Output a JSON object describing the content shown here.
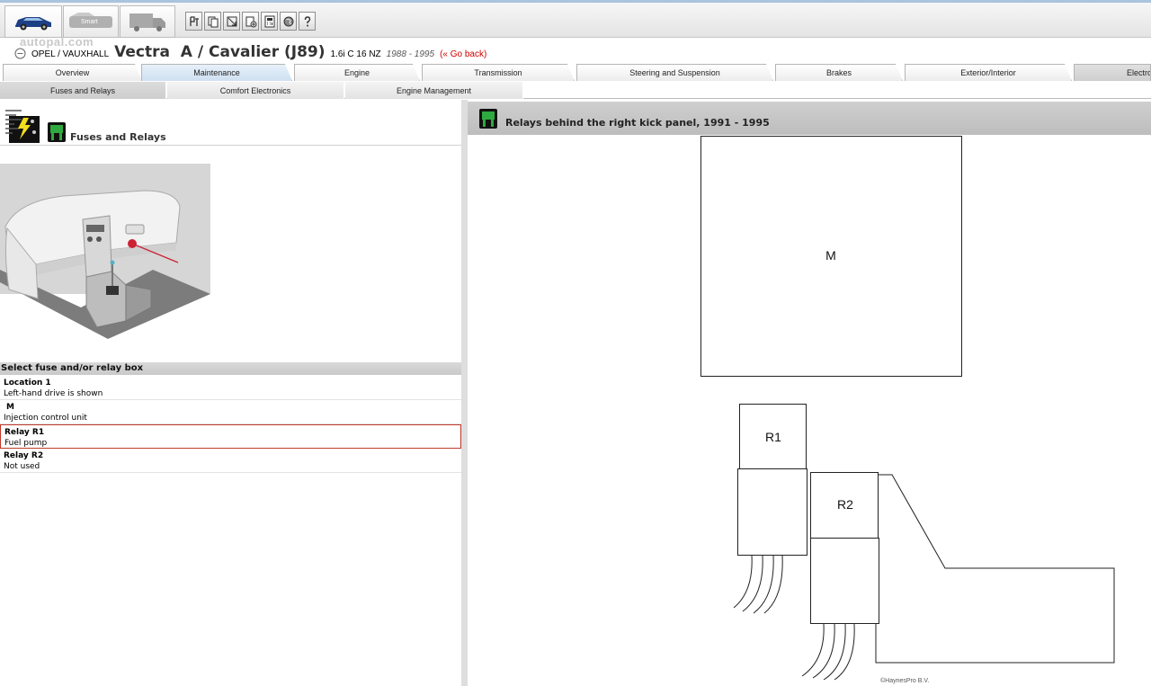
{
  "toolbar": {
    "modes": [
      {
        "id": "car",
        "icon": "car-icon",
        "label": ""
      },
      {
        "id": "smart",
        "icon": "smart-icon",
        "label": "Smart"
      },
      {
        "id": "truck",
        "icon": "truck-icon",
        "label": ""
      }
    ],
    "tools": [
      "tool-1-icon",
      "copy-icon",
      "resize-icon",
      "add-document-icon",
      "calculator-icon",
      "globe-icon",
      "help-icon"
    ],
    "watermark": "autopal.com"
  },
  "vehicle": {
    "make": "OPEL / VAUXHALL",
    "model": "Vectra  A / Cavalier (J89)",
    "engine": "1.6i C 16 NZ",
    "years": "1988 - 1995",
    "back_link": "(« Go back)"
  },
  "tabs": [
    {
      "label": "Overview"
    },
    {
      "label": "Maintenance"
    },
    {
      "label": "Engine"
    },
    {
      "label": "Transmission"
    },
    {
      "label": "Steering and Suspension"
    },
    {
      "label": "Brakes"
    },
    {
      "label": "Exterior/Interior"
    },
    {
      "label": "Electronics"
    }
  ],
  "subtabs": [
    {
      "label": "Fuses and Relays"
    },
    {
      "label": "Comfort Electronics"
    },
    {
      "label": "Engine Management"
    }
  ],
  "left_panel": {
    "title": "Fuses and Relays",
    "list_header": "Select fuse and/or relay box",
    "items": [
      {
        "title": "Location 1",
        "subtitle": "Left-hand drive is shown"
      },
      {
        "title": "M",
        "subtitle": "Injection control unit"
      },
      {
        "title": "Relay R1",
        "subtitle": "Fuel pump"
      },
      {
        "title": "Relay R2",
        "subtitle": "Not used"
      }
    ]
  },
  "right_panel": {
    "title": "Relays behind the right kick panel, 1991 - 1995",
    "labels": {
      "m": "M",
      "r1": "R1",
      "r2": "R2"
    },
    "copyright": "©HaynesPro B.V."
  }
}
